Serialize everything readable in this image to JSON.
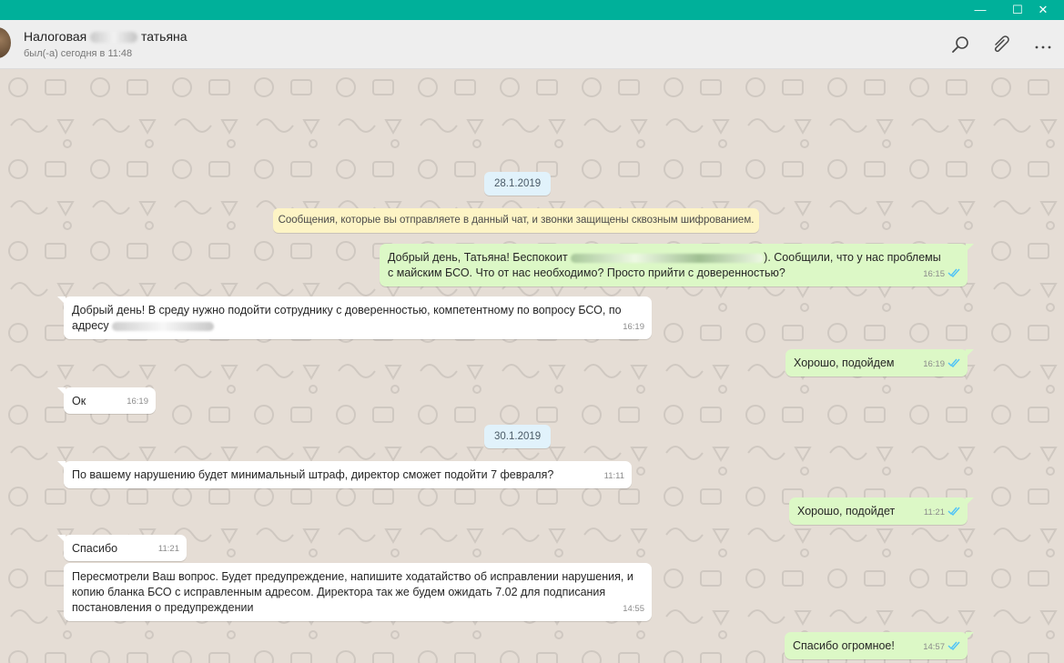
{
  "window": {
    "colors": {
      "titlebar": "#00b09a",
      "chat_bg": "#e5ddd5",
      "bubble_out": "#dcf8c6",
      "bubble_in": "#ffffff",
      "read_ticks": "#4fc3f7"
    },
    "buttons": {
      "minimize": "—",
      "maximize": "☐",
      "close": "✕"
    }
  },
  "header": {
    "contact_name_prefix": "Налоговая",
    "contact_name_suffix": "татьяна",
    "status": "был(-а) сегодня в 11:48",
    "icons": [
      "search-icon",
      "paperclip-icon",
      "more-icon"
    ]
  },
  "chat": {
    "dates": {
      "first": "28.1.2019",
      "second": "30.1.2019"
    },
    "encryption_notice": "Сообщения, которые вы отправляете в данный чат, и звонки защищены сквозным шифрованием.",
    "messages": [
      {
        "dir": "out",
        "text_start": "Добрый день, Татьяна! Беспокоит",
        "text_end": "). Сообщили, что у нас проблемы",
        "text_line2": "с майским БСО. Что от нас необходимо? Просто прийти с доверенностью?",
        "time": "16:15",
        "ticks": "read"
      },
      {
        "dir": "in",
        "text_line1": "Добрый день! В среду нужно подойти сотруднику с доверенностью, компетентному по вопросу БСО, по",
        "text_line2": "адресу",
        "time": "16:19"
      },
      {
        "dir": "out",
        "text": "Хорошо, подойдем",
        "time": "16:19",
        "ticks": "read"
      },
      {
        "dir": "in",
        "text": "Ок",
        "time": "16:19"
      },
      {
        "dir": "in",
        "text": "По вашему нарушению будет минимальный штраф, директор сможет подойти 7 февраля?",
        "time": "11:11"
      },
      {
        "dir": "out",
        "text": "Хорошо, подойдет",
        "time": "11:21",
        "ticks": "read"
      },
      {
        "dir": "in",
        "text": "Спасибо",
        "time": "11:21"
      },
      {
        "dir": "in",
        "text": "Пересмотрели Ваш вопрос. Будет предупреждение, напишите ходатайство об исправлении нарушения, и\nкопию бланка БСО с исправленным адресом. Директора так же будем ожидать 7.02 для подписания\nпостановления о предупреждении",
        "time": "14:55"
      },
      {
        "dir": "out",
        "text": "Спасибо огромное!",
        "time": "14:57",
        "ticks": "read"
      }
    ]
  }
}
